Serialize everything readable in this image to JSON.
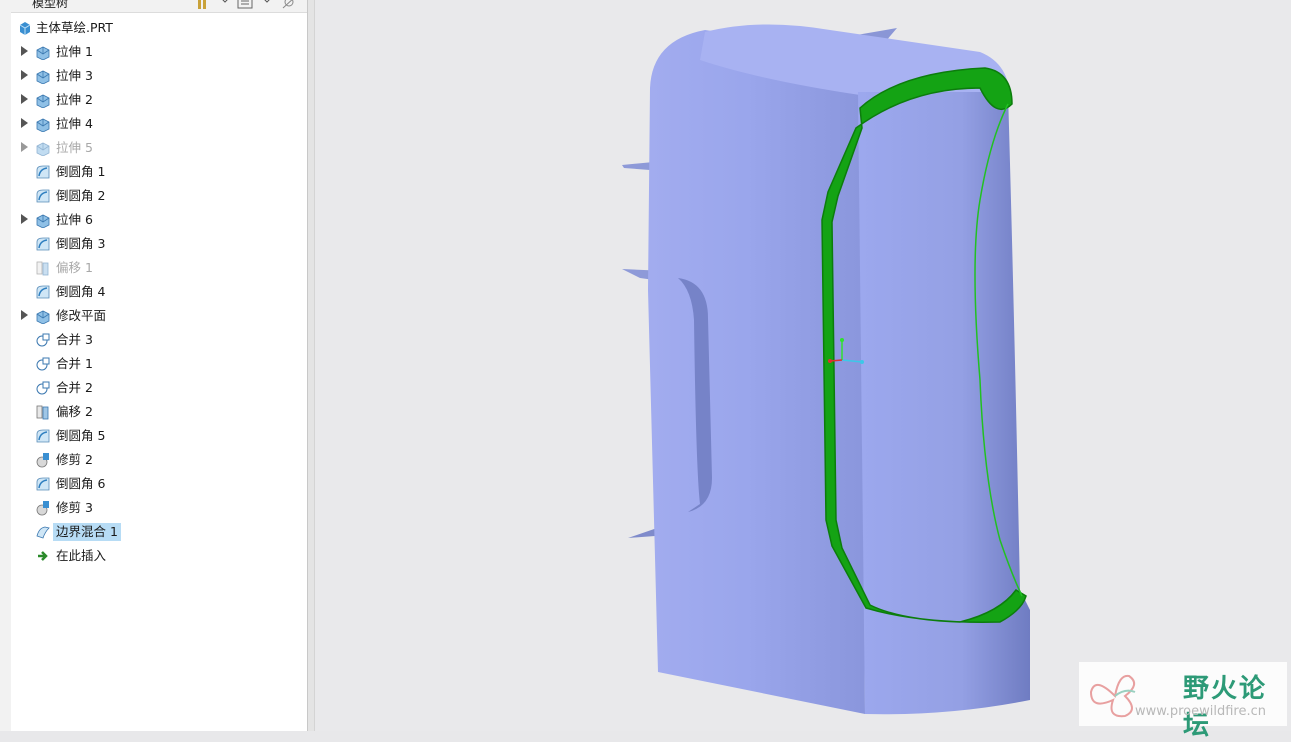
{
  "panel": {
    "title": "模型树",
    "root_label": "主体草绘.PRT"
  },
  "tree_items": [
    {
      "label": "拉伸 1",
      "icon": "extrude-icon",
      "expandable": true,
      "dim": false
    },
    {
      "label": "拉伸 3",
      "icon": "extrude-icon",
      "expandable": true,
      "dim": false
    },
    {
      "label": "拉伸 2",
      "icon": "extrude-icon",
      "expandable": true,
      "dim": false
    },
    {
      "label": "拉伸 4",
      "icon": "extrude-icon",
      "expandable": true,
      "dim": false
    },
    {
      "label": "拉伸 5",
      "icon": "extrude-icon",
      "expandable": true,
      "dim": true
    },
    {
      "label": "倒圆角 1",
      "icon": "round-icon",
      "expandable": false,
      "dim": false
    },
    {
      "label": "倒圆角 2",
      "icon": "round-icon",
      "expandable": false,
      "dim": false
    },
    {
      "label": "拉伸 6",
      "icon": "extrude-icon",
      "expandable": true,
      "dim": false
    },
    {
      "label": "倒圆角 3",
      "icon": "round-icon",
      "expandable": false,
      "dim": false
    },
    {
      "label": "偏移 1",
      "icon": "offset-icon",
      "expandable": false,
      "dim": true
    },
    {
      "label": "倒圆角 4",
      "icon": "round-icon",
      "expandable": false,
      "dim": false
    },
    {
      "label": "修改平面",
      "icon": "extrude-icon",
      "expandable": true,
      "dim": false
    },
    {
      "label": "合并 3",
      "icon": "merge-icon",
      "expandable": false,
      "dim": false
    },
    {
      "label": "合并 1",
      "icon": "merge-icon",
      "expandable": false,
      "dim": false
    },
    {
      "label": "合并 2",
      "icon": "merge-icon",
      "expandable": false,
      "dim": false
    },
    {
      "label": "偏移 2",
      "icon": "offset-icon",
      "expandable": false,
      "dim": false
    },
    {
      "label": "倒圆角 5",
      "icon": "round-icon",
      "expandable": false,
      "dim": false
    },
    {
      "label": "修剪 2",
      "icon": "trim-icon",
      "expandable": false,
      "dim": false
    },
    {
      "label": "倒圆角 6",
      "icon": "round-icon",
      "expandable": false,
      "dim": false
    },
    {
      "label": "修剪 3",
      "icon": "trim-icon",
      "expandable": false,
      "dim": false
    },
    {
      "label": "边界混合 1",
      "icon": "boundary-blend-icon",
      "expandable": false,
      "dim": false,
      "selected": true
    },
    {
      "label": "在此插入",
      "icon": "insert-here-icon",
      "expandable": false,
      "dim": false
    }
  ],
  "watermark": {
    "title": "野火论坛",
    "url": "www.proewildfire.cn"
  },
  "colors": {
    "surface": "#9aa8ec",
    "selection_edge": "#11a111",
    "selected_bg": "#b7dcf5"
  }
}
